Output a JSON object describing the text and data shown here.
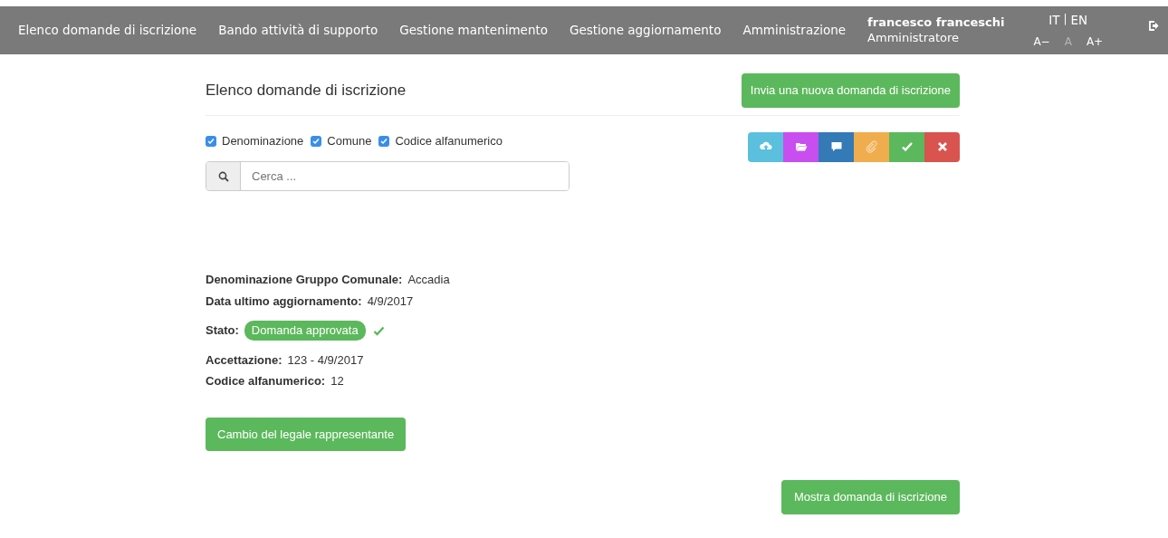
{
  "navbar": {
    "items": [
      {
        "label": "Elenco domande di iscrizione"
      },
      {
        "label": "Bando attività di supporto"
      },
      {
        "label": "Gestione mantenimento"
      },
      {
        "label": "Gestione aggiornamento"
      },
      {
        "label": "Amministrazione"
      }
    ],
    "user": {
      "name": "francesco franceschi",
      "role": "Amministratore"
    },
    "languages": [
      "IT",
      "EN"
    ],
    "language_separator": "|",
    "font_sizes": [
      {
        "label": "A−",
        "selected": false
      },
      {
        "label": "A",
        "selected": true
      },
      {
        "label": "A+",
        "selected": false
      }
    ]
  },
  "page": {
    "title": "Elenco domande di iscrizione",
    "new_button": "Invia una nuova domanda di iscrizione",
    "filters": [
      {
        "label": "Denominazione",
        "checked": true
      },
      {
        "label": "Comune",
        "checked": true
      },
      {
        "label": "Codice alfanumerico",
        "checked": true
      }
    ],
    "search": {
      "placeholder": "Cerca ..."
    },
    "actions": [
      {
        "kind": "upload",
        "color": "#5bc0de",
        "disabled": false
      },
      {
        "kind": "folder",
        "color": "#c84ef0",
        "disabled": false
      },
      {
        "kind": "comment",
        "color": "#337ab7",
        "disabled": false
      },
      {
        "kind": "attach",
        "color": "#f0ad4e",
        "disabled": true
      },
      {
        "kind": "approve",
        "color": "#5cb85c",
        "disabled": false
      },
      {
        "kind": "reject",
        "color": "#d9534f",
        "disabled": false
      }
    ]
  },
  "record": {
    "group_a": [
      {
        "label": "Denominazione Gruppo Comunale:",
        "value": "Accadia"
      },
      {
        "label": "Data ultimo aggiornamento:",
        "value": "4/9/2017"
      }
    ],
    "status": {
      "label": "Stato:",
      "value": "Domanda approvata",
      "approved": true
    },
    "group_b": [
      {
        "label": "Accettazione:",
        "value": "123 - 4/9/2017"
      },
      {
        "label": "Codice alfanumerico:",
        "value": "12"
      }
    ],
    "change_button": "Cambio del legale rappresentante",
    "show_button": "Mostra domanda di iscrizione"
  }
}
